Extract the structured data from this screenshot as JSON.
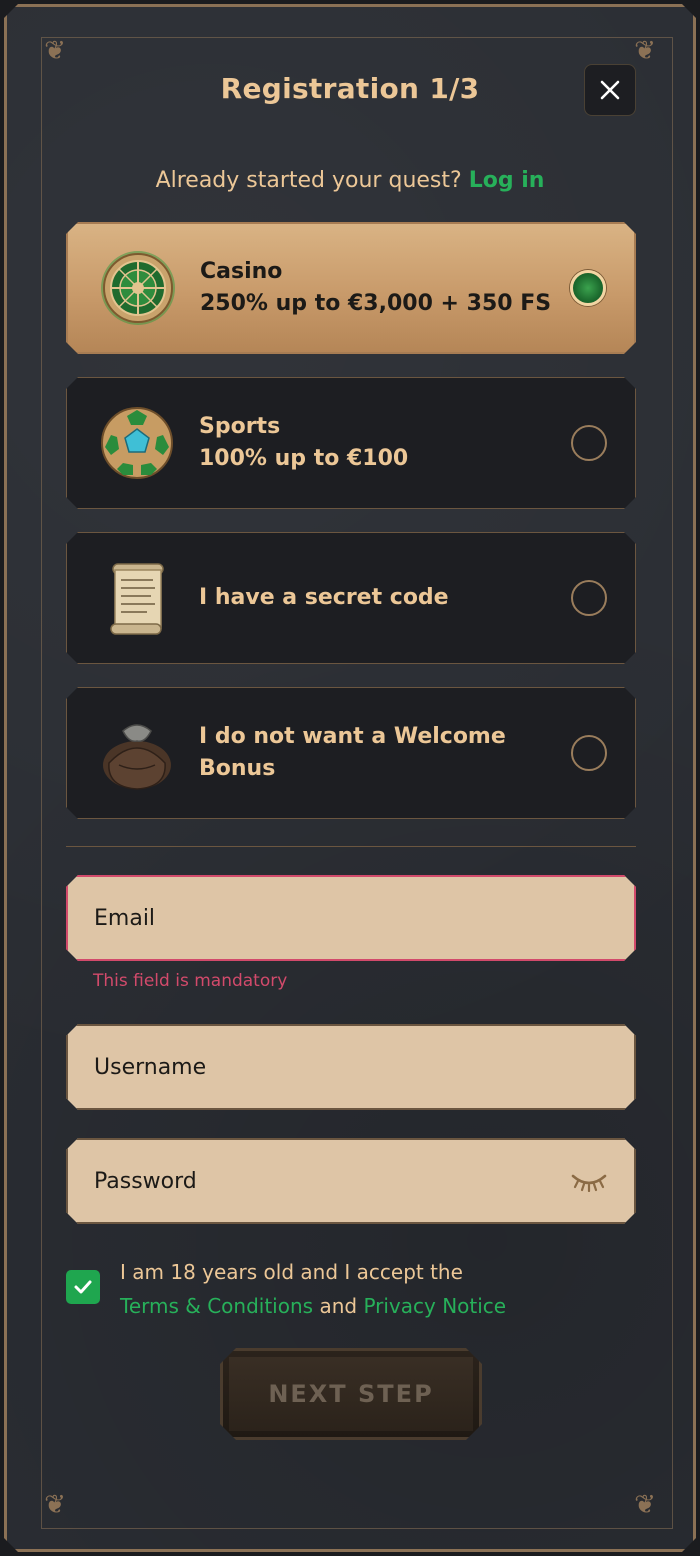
{
  "header": {
    "title": "Registration 1/3",
    "close_label": "close"
  },
  "login_prompt": {
    "text": "Already started your quest?",
    "link": "Log in"
  },
  "bonus_options": [
    {
      "line1": "Casino",
      "line2": "250% up to €3,000 + 350 FS",
      "icon": "roulette-icon",
      "selected": true
    },
    {
      "line1": "Sports",
      "line2": "100% up to €100",
      "icon": "football-icon",
      "selected": false
    },
    {
      "line1": "I have a secret code",
      "line2": "",
      "icon": "scroll-icon",
      "selected": false
    },
    {
      "line1": "I do not want a Welcome Bonus",
      "line2": "",
      "icon": "pouch-icon",
      "selected": false
    }
  ],
  "form": {
    "email_placeholder": "Email",
    "email_error": "This field is mandatory",
    "username_placeholder": "Username",
    "password_placeholder": "Password"
  },
  "consent": {
    "text_before": "I am 18 years old and I accept the",
    "terms": "Terms & Conditions",
    "and": "and",
    "privacy": "Privacy Notice",
    "checked": true
  },
  "next_button": "NEXT STEP",
  "colors": {
    "gold": "#ecc797",
    "link_green": "#27b05a",
    "error": "#d24a6b",
    "field_bg": "#dec5a6"
  }
}
